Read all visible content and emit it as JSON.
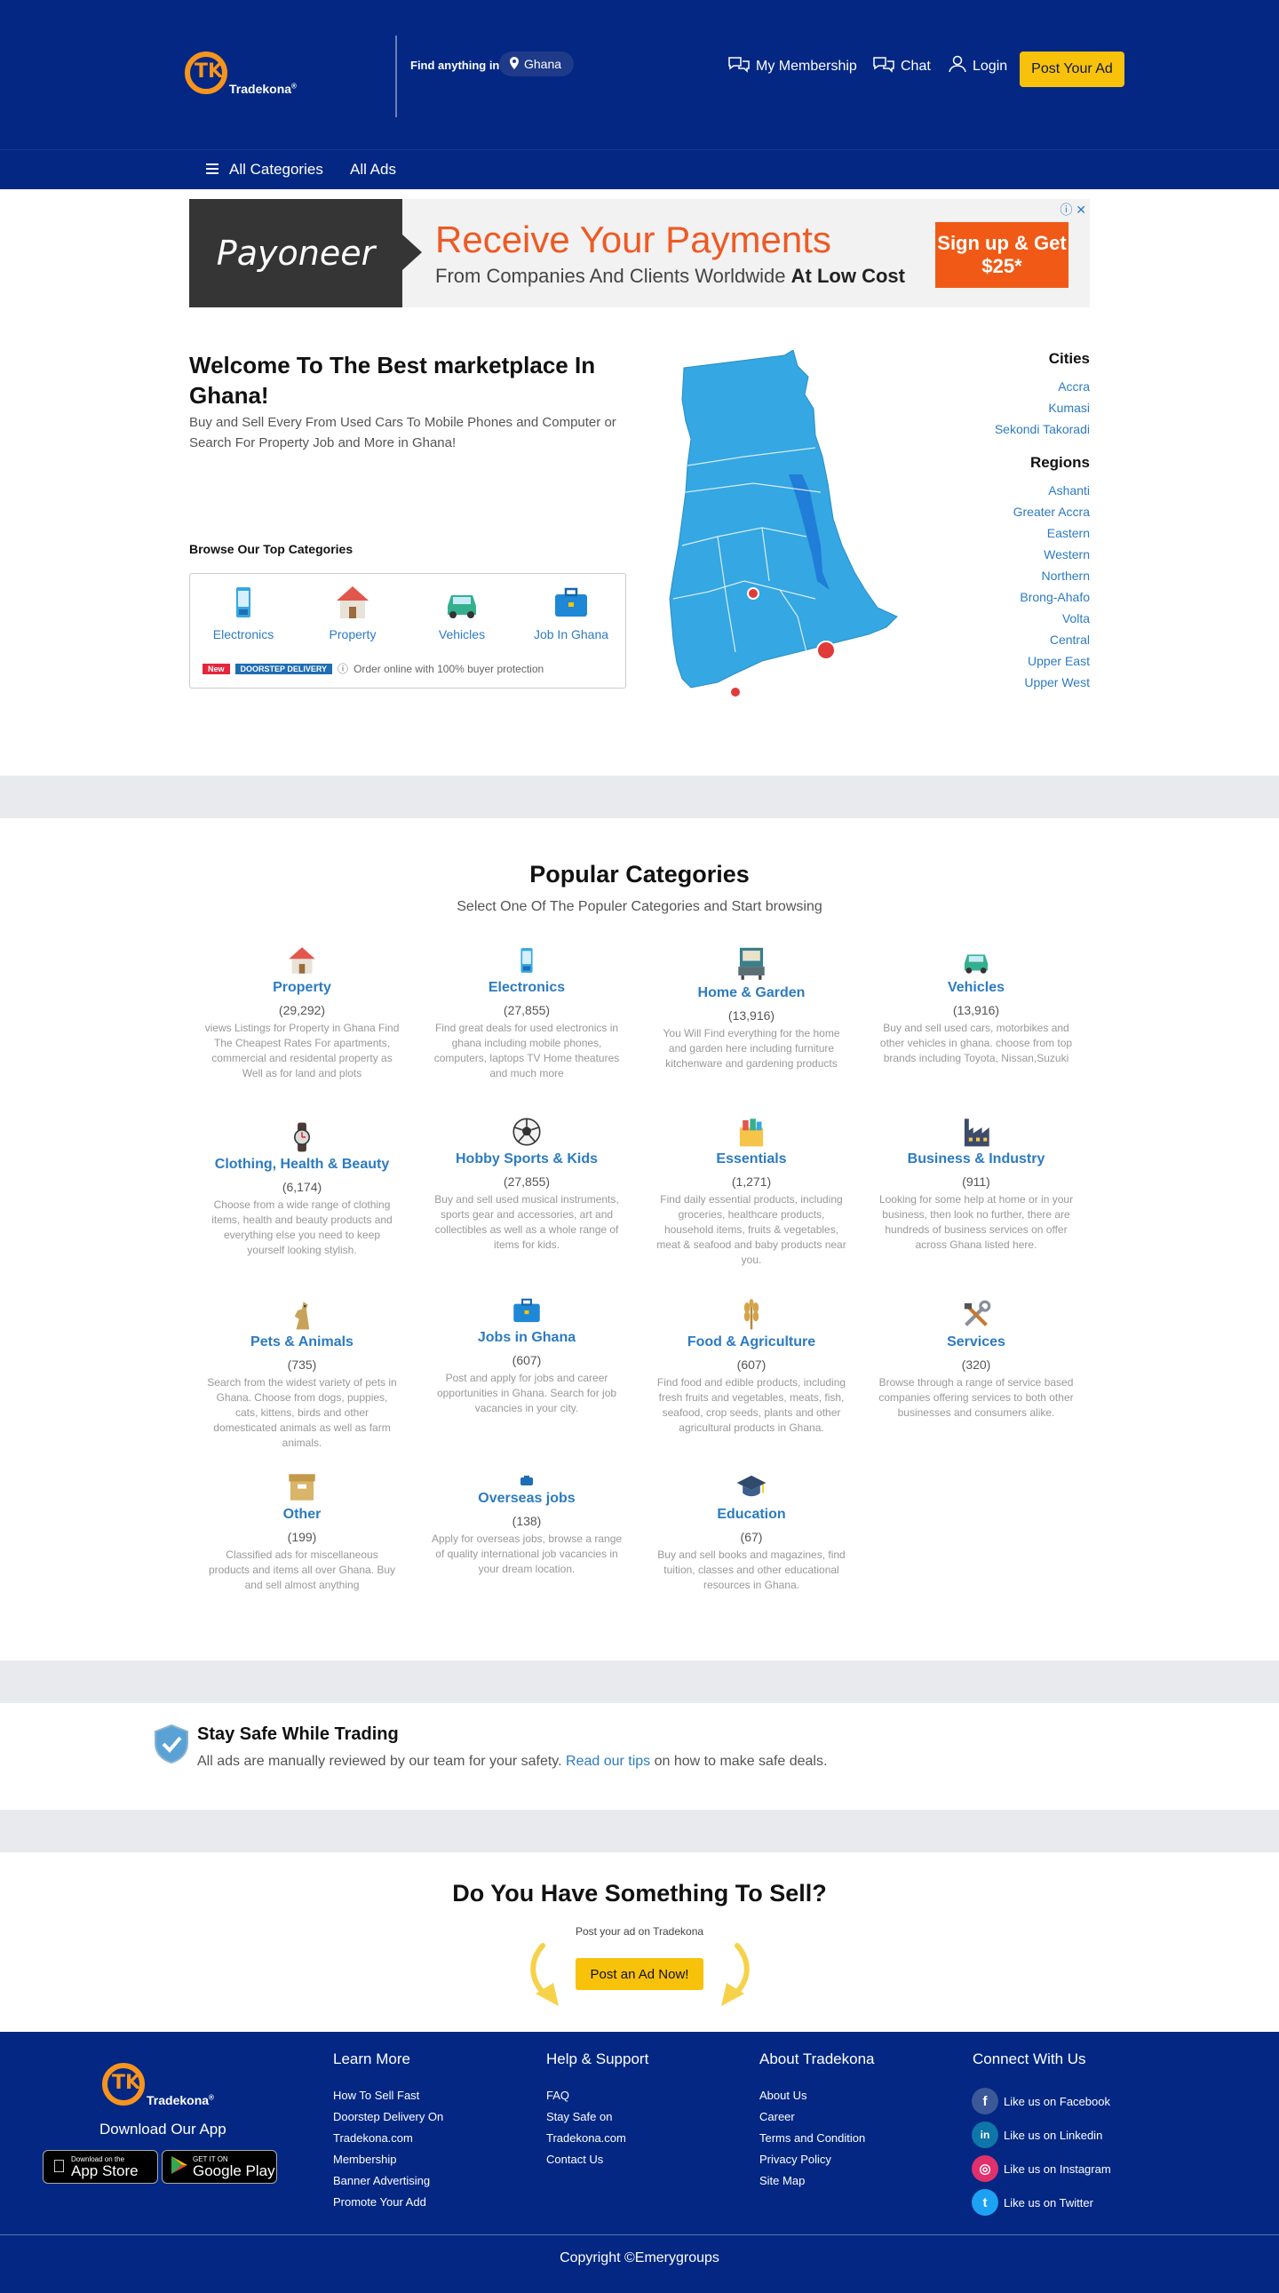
{
  "header": {
    "brand": "Tradekona",
    "brand_mark": "TK",
    "find_label": "Find anything in",
    "location": "Ghana",
    "membership": "My Membership",
    "chat": "Chat",
    "login": "Login",
    "post_ad": "Post Your Ad"
  },
  "nav": {
    "all_categories": "All Categories",
    "all_ads": "All Ads"
  },
  "banner": {
    "brand": "Payoneer",
    "headline": "Receive Your Payments",
    "subline": "From Companies And Clients Worldwide",
    "subline_bold": "At Low Cost",
    "cta": "Sign up & Get $25*"
  },
  "hero": {
    "title": "Welcome To The Best marketplace In Ghana!",
    "subtitle": "Buy and Sell Every From Used Cars To Mobile Phones and Computer or Search For Property Job and More in Ghana!",
    "browse_title": "Browse Our Top Categories",
    "top_categories": [
      {
        "label": "Electronics",
        "icon": "phone-icon"
      },
      {
        "label": "Property",
        "icon": "house-icon"
      },
      {
        "label": "Vehicles",
        "icon": "car-icon"
      },
      {
        "label": "Job In Ghana",
        "icon": "briefcase-icon"
      }
    ],
    "tag_new": "New",
    "tag_delivery": "DOORSTEP DELIVERY",
    "delivery_text": "Order online with 100% buyer protection"
  },
  "sidebar": {
    "cities_title": "Cities",
    "cities": [
      "Accra",
      "Kumasi",
      "Sekondi Takoradi"
    ],
    "regions_title": "Regions",
    "regions": [
      "Ashanti",
      "Greater Accra",
      "Eastern",
      "Western",
      "Northern",
      "Brong-Ahafo",
      "Volta",
      "Central",
      "Upper East",
      "Upper West"
    ]
  },
  "popular": {
    "title": "Popular Categories",
    "subtitle": "Select One Of The Populer Categories and Start browsing",
    "items": [
      {
        "name": "Property",
        "count": "(29,292)",
        "desc": "views Listings for Property in Ghana Find The Cheapest Rates For apartments, commercial and residental property as Well as for land and plots",
        "icon": "house-icon"
      },
      {
        "name": "Electronics",
        "count": "(27,855)",
        "desc": "Find great deals for used electronics in ghana including mobile phones, computers, laptops TV Home theatures and much more",
        "icon": "phone-icon"
      },
      {
        "name": "Home & Garden",
        "count": "(13,916)",
        "desc": "You Will Find everything for the home and garden here including furniture kitchenware and gardening products",
        "icon": "sofa-icon"
      },
      {
        "name": "Vehicles",
        "count": "(13,916)",
        "desc": "Buy and sell used cars, motorbikes and other vehicles in ghana. choose from top brands including Toyota, Nissan,Suzuki",
        "icon": "car-icon"
      },
      {
        "name": "Clothing, Health & Beauty",
        "count": "(6,174)",
        "desc": "Choose from a wide range of clothing items, health and beauty products and everything else you need to keep yourself looking stylish.",
        "icon": "watch-icon"
      },
      {
        "name": "Hobby Sports & Kids",
        "count": "(27,855)",
        "desc": "Buy and sell used musical instruments, sports gear and accessories, art and collectibles as well as a whole range of items for kids.",
        "icon": "football-icon"
      },
      {
        "name": "Essentials",
        "count": "(1,271)",
        "desc": "Find daily essential products, including groceries, healthcare products, household items, fruits & vegetables, meat & seafood and baby products near you.",
        "icon": "grocery-icon"
      },
      {
        "name": "Business & Industry",
        "count": "(911)",
        "desc": "Looking for some help at home or in your business, then look no further, there are hundreds of business services on offer across Ghana listed here.",
        "icon": "factory-icon"
      },
      {
        "name": "Pets & Animals",
        "count": "(735)",
        "desc": "Search from the widest variety of pets in Ghana. Choose from dogs, puppies, cats, kittens, birds and other domesticated animals as well as farm animals.",
        "icon": "dog-icon"
      },
      {
        "name": "Jobs in Ghana",
        "count": "(607)",
        "desc": "Post and apply for jobs and career opportunities in Ghana. Search for job vacancies in your city.",
        "icon": "briefcase-icon"
      },
      {
        "name": "Food & Agriculture",
        "count": "(607)",
        "desc": "Find food and edible products, including fresh fruits and vegetables, meats, fish, seafood, crop seeds, plants and other agricultural products in Ghana.",
        "icon": "wheat-icon"
      },
      {
        "name": "Services",
        "count": "(320)",
        "desc": "Browse through a range of service based companies offering services to both other businesses and consumers alike.",
        "icon": "tools-icon"
      },
      {
        "name": "Other",
        "count": "(199)",
        "desc": "Classified ads for miscellaneous products and items all over Ghana. Buy and sell almost anything",
        "icon": "box-icon"
      },
      {
        "name": "Overseas jobs",
        "count": "(138)",
        "desc": "Apply for overseas jobs, browse a range of quality international job vacancies in your dream location.",
        "icon": "plane-icon"
      },
      {
        "name": "Education",
        "count": "(67)",
        "desc": "Buy and sell books and magazines, find tuition, classes and other educational resources in Ghana.",
        "icon": "graduation-cap-icon"
      }
    ]
  },
  "safety": {
    "title": "Stay Safe While Trading",
    "text_before": "All ads are manually reviewed by our team for your safety.",
    "link": "Read our tips",
    "text_after": "on how to make safe deals."
  },
  "sell": {
    "title": "Do You Have Something To Sell?",
    "subtitle": "Post your ad on Tradekona",
    "button": "Post an Ad Now!"
  },
  "footer": {
    "download": "Download Our App",
    "app_store_small": "Download on the",
    "app_store": "App Store",
    "google_small": "GET IT ON",
    "google": "Google Play",
    "learn_title": "Learn More",
    "learn_links": [
      "How To Sell Fast",
      "Doorstep Delivery On",
      "Tradekona.com",
      "Membership",
      "Banner Advertising",
      "Promote Your Add"
    ],
    "help_title": "Help & Support",
    "help_links": [
      "FAQ",
      "Stay Safe on",
      "Tradekona.com",
      "Contact Us"
    ],
    "about_title": "About Tradekona",
    "about_links": [
      "About Us",
      "Career",
      "Terms and Condition",
      "Privacy Policy",
      "Site Map"
    ],
    "connect_title": "Connect With Us",
    "social": [
      {
        "label": "Like us on Facebook",
        "icon": "facebook-icon",
        "color": "#3b5998",
        "glyph": "f"
      },
      {
        "label": "Like us on Linkedin",
        "icon": "linkedin-icon",
        "color": "#0e76a8",
        "glyph": "in"
      },
      {
        "label": "Like us on Instagram",
        "icon": "instagram-icon",
        "color": "#e1306c",
        "glyph": "◎"
      },
      {
        "label": "Like us on Twitter",
        "icon": "twitter-icon",
        "color": "#1da1f2",
        "glyph": "t"
      }
    ],
    "copyright": "Copyright ©Emerygroups"
  },
  "colors": {
    "header_bg": "#032783",
    "accent_yellow": "#f9c20a",
    "link_blue": "#2c7bc1",
    "brand_orange": "#f7941d",
    "map_blue": "#35a7e2"
  }
}
